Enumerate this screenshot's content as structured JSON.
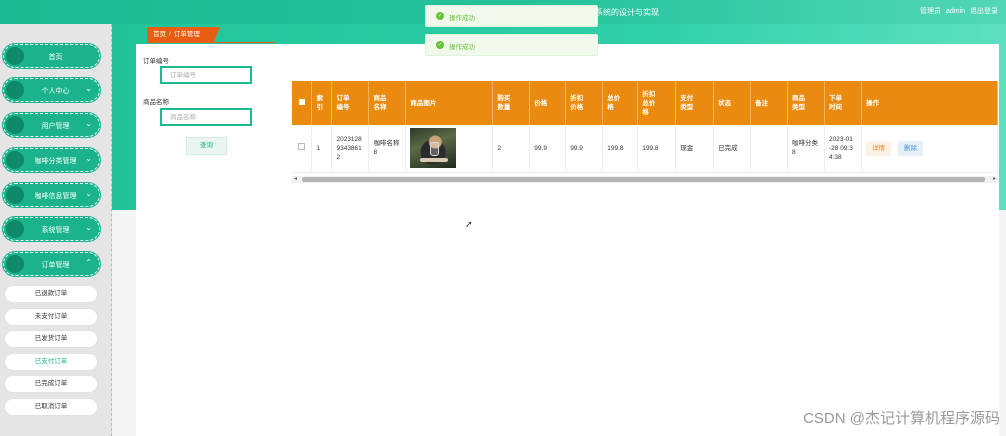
{
  "header": {
    "title": "系统的设计与实现",
    "user_role": "管理员",
    "username": "admin",
    "logout": "退出登录"
  },
  "toasts": [
    "操作成功",
    "操作成功"
  ],
  "sidebar": {
    "items": [
      {
        "label": "首页"
      },
      {
        "label": "个人中心"
      },
      {
        "label": "用户管理"
      },
      {
        "label": "咖啡分类管理"
      },
      {
        "label": "咖啡信息管理"
      },
      {
        "label": "系统管理"
      },
      {
        "label": "订单管理"
      }
    ],
    "sub_items": [
      {
        "label": "已退款订单"
      },
      {
        "label": "未支付订单"
      },
      {
        "label": "已发货订单"
      },
      {
        "label": "已支付订单"
      },
      {
        "label": "已完成订单"
      },
      {
        "label": "已取消订单"
      }
    ]
  },
  "breadcrumb": {
    "home": "首页",
    "separator": "/",
    "current": "订单管理"
  },
  "search": {
    "order_no_label": "订单编号",
    "order_no_placeholder": "订单编号",
    "product_name_label": "商品名称",
    "product_name_placeholder": "商品名称",
    "button": "查询"
  },
  "table": {
    "headers": [
      "索引",
      "订单编号",
      "商品名称",
      "商品图片",
      "购买数量",
      "价格",
      "折扣价格",
      "总价格",
      "折扣总价格",
      "支付类型",
      "状态",
      "备注",
      "商品类型",
      "下单时间",
      "操作"
    ],
    "header_display": [
      "索\n引",
      "订单\n编号",
      "商品\n名称",
      "商品图片",
      "购买\n数量",
      "价格",
      "折扣\n价格",
      "总价\n格",
      "折扣\n总价\n格",
      "支付\n类型",
      "状态",
      "备注",
      "商品\n类型",
      "下单\n时间",
      "操作"
    ],
    "rows": [
      {
        "index": "1",
        "order_no": "20231289343861\n2",
        "order_no_display": "2023128\n9343861\n2",
        "product_name": "咖啡名称\n8",
        "image": "coffee-image",
        "quantity": "2",
        "price": "99.9",
        "discount_price": "99.9",
        "total_price": "199.8",
        "discount_total": "199.8",
        "pay_type": "现金",
        "status": "已完成",
        "remark": "",
        "category": "咖啡分类\n8",
        "order_time": "2023-01\n-28 09:3\n4:38",
        "actions": {
          "detail": "详情",
          "delete": "删除"
        }
      }
    ]
  },
  "watermark": "CSDN @杰记计算机程序源码",
  "colors": {
    "primary": "#1ab38b",
    "header_orange": "#ea8a0e",
    "breadcrumb": "#e85d12",
    "success": "#67c23a"
  }
}
